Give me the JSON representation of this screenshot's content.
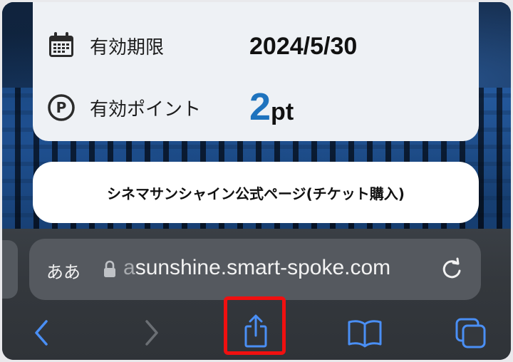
{
  "card": {
    "expiry_label": "有効期限",
    "expiry_value": "2024/5/30",
    "points_label": "有効ポイント",
    "points_value": "2",
    "points_unit": "pt"
  },
  "official_button": {
    "label": "シネマサンシャイン公式ページ(チケット購入)"
  },
  "browser": {
    "text_size_label": "ああ",
    "url_prefix": "a",
    "url_main": "sunshine.smart-spoke.com"
  },
  "toolbar": {
    "items": [
      "back-icon",
      "forward-icon",
      "share-icon",
      "bookmarks-icon",
      "tabs-icon"
    ]
  },
  "colors": {
    "accent_blue": "#1e73be",
    "toolbar_blue": "#4a8ff5",
    "highlight_red": "#f01010"
  }
}
